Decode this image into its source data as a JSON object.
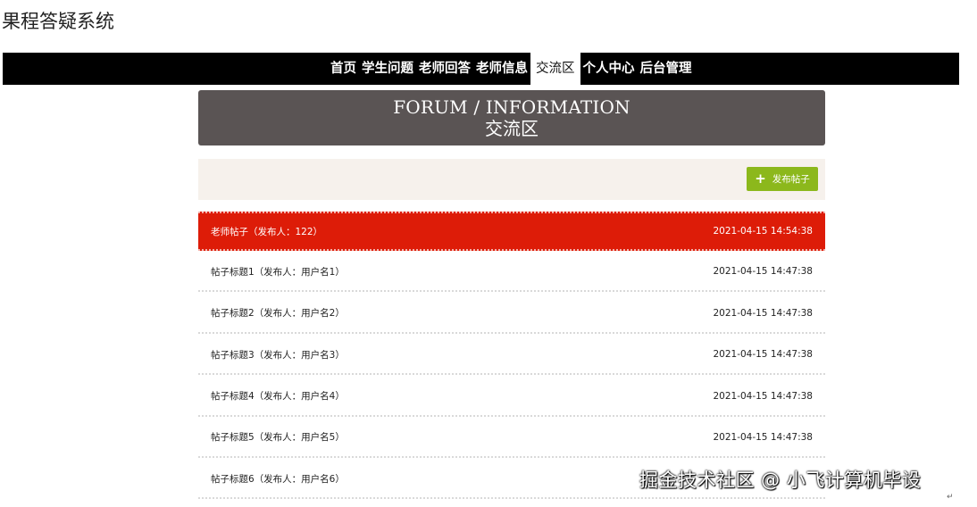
{
  "site": {
    "title": "果程答疑系统"
  },
  "nav": {
    "items": [
      {
        "label": "首页"
      },
      {
        "label": "学生问题"
      },
      {
        "label": "老师回答"
      },
      {
        "label": "老师信息"
      },
      {
        "label": "交流区"
      },
      {
        "label": "个人中心"
      },
      {
        "label": "后台管理"
      }
    ],
    "active": "交流区"
  },
  "banner": {
    "title_en": "FORUM / INFORMATION",
    "title_cn": "交流区"
  },
  "toolbar": {
    "post_button_label": "发布帖子"
  },
  "posts": [
    {
      "title": "老师帖子（发布人：122）",
      "time": "2021-04-15 14:54:38"
    },
    {
      "title": "帖子标题1（发布人：用户名1）",
      "time": "2021-04-15 14:47:38"
    },
    {
      "title": "帖子标题2（发布人：用户名2）",
      "time": "2021-04-15 14:47:38"
    },
    {
      "title": "帖子标题3（发布人：用户名3）",
      "time": "2021-04-15 14:47:38"
    },
    {
      "title": "帖子标题4（发布人：用户名4）",
      "time": "2021-04-15 14:47:38"
    },
    {
      "title": "帖子标题5（发布人：用户名5）",
      "time": "2021-04-15 14:47:38"
    },
    {
      "title": "帖子标题6（发布人：用户名6）",
      "time": ""
    }
  ],
  "watermark": {
    "text": "掘金技术社区 @ 小飞计算机毕设"
  },
  "colors": {
    "nav_bg": "#000000",
    "banner_bg": "#5a5454",
    "toolbar_bg": "#f6f1ec",
    "post_button": "#8cb81c",
    "highlight_row": "#dd1c08"
  }
}
